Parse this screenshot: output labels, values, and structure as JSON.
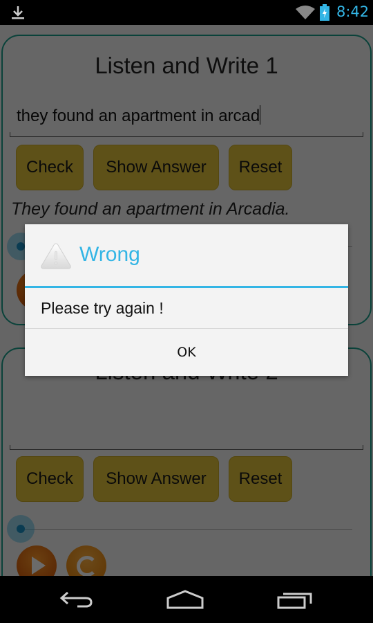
{
  "status_bar": {
    "left_icons": [
      "download-icon"
    ],
    "right_icons": [
      "wifi-icon",
      "battery-charging-icon"
    ],
    "time": "8:42"
  },
  "exercises": [
    {
      "title": "Listen and Write 1",
      "input_value": "they found an apartment in arcad",
      "buttons": {
        "check": "Check",
        "show_answer": "Show Answer",
        "reset": "Reset"
      },
      "answer_text": "They found an apartment in Arcadia.",
      "seek_progress": 0,
      "media_icons": [
        "play-icon",
        "replay-icon"
      ]
    },
    {
      "title": "Listen and Write 2",
      "input_value": "",
      "buttons": {
        "check": "Check",
        "show_answer": "Show Answer",
        "reset": "Reset"
      },
      "answer_text": "",
      "seek_progress": 0,
      "media_icons": [
        "play-icon",
        "replay-icon"
      ]
    }
  ],
  "dialog": {
    "icon": "warning-icon",
    "title": "Wrong",
    "message": "Please try again !",
    "ok_label": "OK",
    "accent_color": "#33b5e5"
  },
  "nav_bar": {
    "icons": [
      "back-icon",
      "home-icon",
      "recent-apps-icon"
    ]
  },
  "colors": {
    "card_border": "#1a9e8a",
    "button_fill": "#e0c23a",
    "accent": "#33b5e5"
  }
}
